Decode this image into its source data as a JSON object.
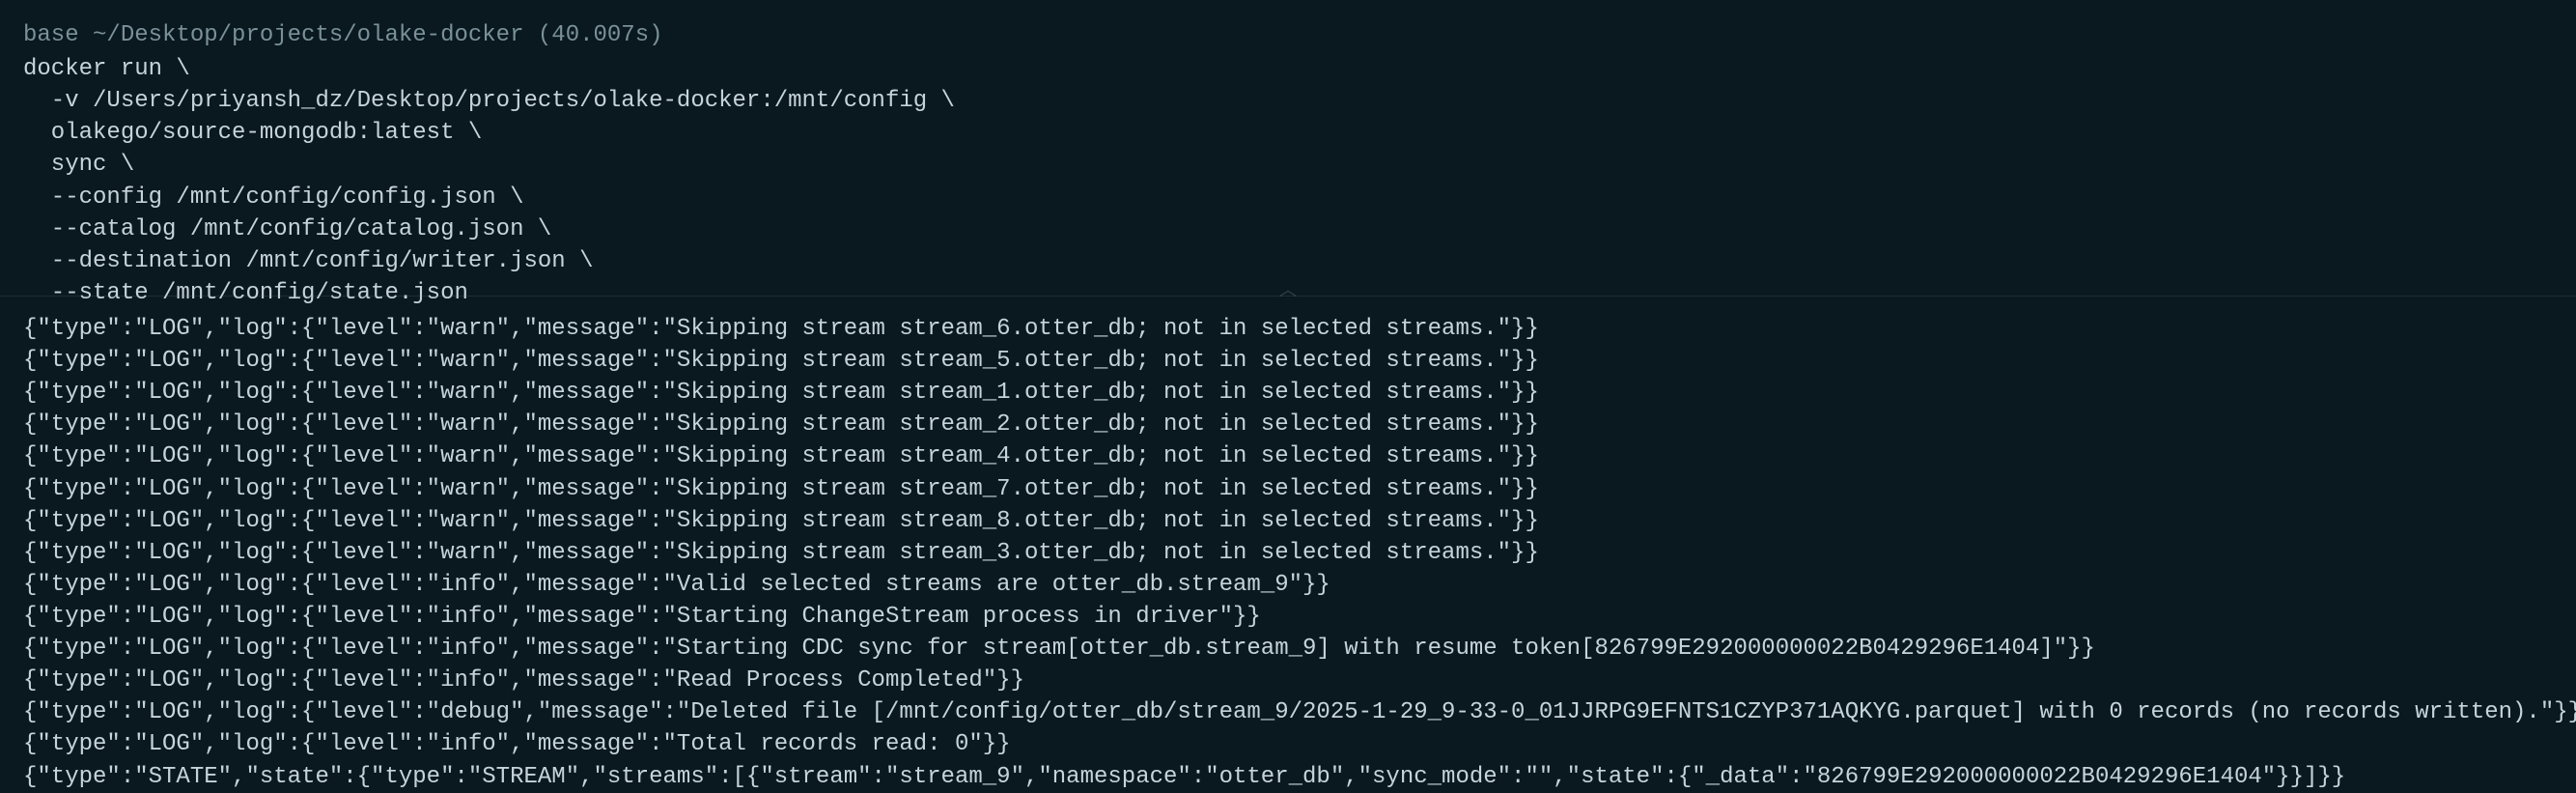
{
  "prompt": "base ~/Desktop/projects/olake-docker (40.007s)",
  "command": {
    "lines": [
      "docker run \\",
      "  -v /Users/priyansh_dz/Desktop/projects/olake-docker:/mnt/config \\",
      "  olakego/source-mongodb:latest \\",
      "  sync \\",
      "  --config /mnt/config/config.json \\",
      "  --catalog /mnt/config/catalog.json \\",
      "  --destination /mnt/config/writer.json \\",
      "  --state /mnt/config/state.json"
    ]
  },
  "output": {
    "lines": [
      "{\"type\":\"LOG\",\"log\":{\"level\":\"warn\",\"message\":\"Skipping stream stream_6.otter_db; not in selected streams.\"}}",
      "{\"type\":\"LOG\",\"log\":{\"level\":\"warn\",\"message\":\"Skipping stream stream_5.otter_db; not in selected streams.\"}}",
      "{\"type\":\"LOG\",\"log\":{\"level\":\"warn\",\"message\":\"Skipping stream stream_1.otter_db; not in selected streams.\"}}",
      "{\"type\":\"LOG\",\"log\":{\"level\":\"warn\",\"message\":\"Skipping stream stream_2.otter_db; not in selected streams.\"}}",
      "{\"type\":\"LOG\",\"log\":{\"level\":\"warn\",\"message\":\"Skipping stream stream_4.otter_db; not in selected streams.\"}}",
      "{\"type\":\"LOG\",\"log\":{\"level\":\"warn\",\"message\":\"Skipping stream stream_7.otter_db; not in selected streams.\"}}",
      "{\"type\":\"LOG\",\"log\":{\"level\":\"warn\",\"message\":\"Skipping stream stream_8.otter_db; not in selected streams.\"}}",
      "{\"type\":\"LOG\",\"log\":{\"level\":\"warn\",\"message\":\"Skipping stream stream_3.otter_db; not in selected streams.\"}}",
      "{\"type\":\"LOG\",\"log\":{\"level\":\"info\",\"message\":\"Valid selected streams are otter_db.stream_9\"}}",
      "{\"type\":\"LOG\",\"log\":{\"level\":\"info\",\"message\":\"Starting ChangeStream process in driver\"}}",
      "{\"type\":\"LOG\",\"log\":{\"level\":\"info\",\"message\":\"Starting CDC sync for stream[otter_db.stream_9] with resume token[826799E292000000022B0429296E1404]\"}}",
      "{\"type\":\"LOG\",\"log\":{\"level\":\"info\",\"message\":\"Read Process Completed\"}}",
      "{\"type\":\"LOG\",\"log\":{\"level\":\"debug\",\"message\":\"Deleted file [/mnt/config/otter_db/stream_9/2025-1-29_9-33-0_01JJRPG9EFNTS1CZYP371AQKYG.parquet] with 0 records (no records written).\"}}",
      "{\"type\":\"LOG\",\"log\":{\"level\":\"info\",\"message\":\"Total records read: 0\"}}",
      "{\"type\":\"STATE\",\"state\":{\"type\":\"STREAM\",\"streams\":[{\"stream\":\"stream_9\",\"namespace\":\"otter_db\",\"sync_mode\":\"\",\"state\":{\"_data\":\"826799E292000000022B0429296E1404\"}}]}}"
    ]
  },
  "chevron": "︿"
}
